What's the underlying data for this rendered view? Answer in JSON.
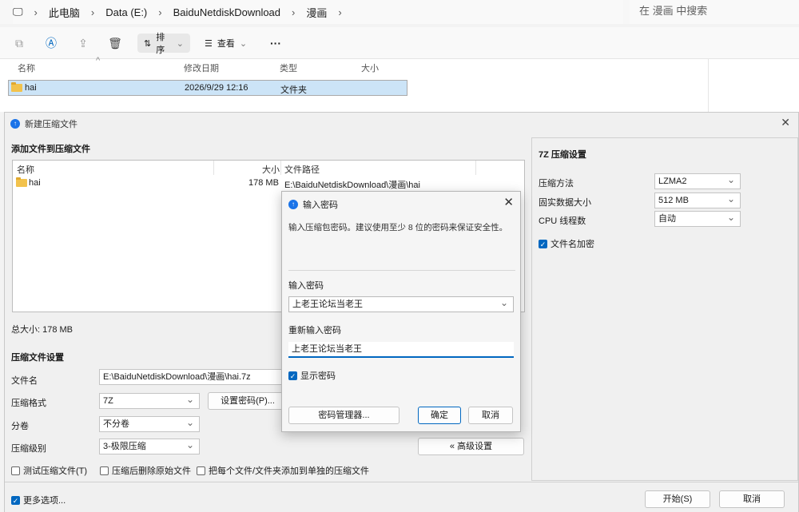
{
  "explorer": {
    "breadcrumb": [
      "此电脑",
      "Data (E:)",
      "BaiduNetdiskDownload",
      "漫画"
    ],
    "search_placeholder": "在 漫画 中搜索",
    "toolbar": {
      "sort_label": "排序",
      "view_label": "查看",
      "more_label": "···"
    },
    "columns": [
      "名称",
      "修改日期",
      "类型",
      "大小"
    ],
    "rows": [
      {
        "name": "hai",
        "modified": "2026/9/29 12:16",
        "type": "文件夹",
        "size": ""
      }
    ]
  },
  "archive_dialog": {
    "title": "新建压缩文件",
    "add_files_heading": "添加文件到压缩文件",
    "file_columns": [
      "名称",
      "大小",
      "文件路径"
    ],
    "files": [
      {
        "name": "hai",
        "size": "178 MB",
        "path": "E:\\BaiduNetdiskDownload\\漫画\\hai"
      }
    ],
    "total_size": "总大小: 178 MB",
    "settings_heading": "压缩文件设置",
    "filename_label": "文件名",
    "filename_value": "E:\\BaiduNetdiskDownload\\漫画\\hai.7z",
    "format_label": "压缩格式",
    "format_value": "7Z",
    "set_password_button": "设置密码(P)...",
    "split_label": "分卷",
    "split_value": "不分卷",
    "level_label": "压缩级别",
    "level_value": "3-极限压缩",
    "advanced_button": "« 高级设置",
    "test_checkbox": "测试压缩文件(T)",
    "delete_checkbox": "压缩后删除原始文件",
    "separate_checkbox": "把每个文件/文件夹添加到单独的压缩文件",
    "more_options": "更多选项...",
    "start_button": "开始(S)",
    "cancel_button": "取消",
    "sevenzip": {
      "heading": "7Z 压缩设置",
      "method_label": "压缩方法",
      "method_value": "LZMA2",
      "solid_label": "固实数据大小",
      "solid_value": "512 MB",
      "threads_label": "CPU 线程数",
      "threads_value": "自动",
      "encrypt_names": "文件名加密"
    }
  },
  "password_dialog": {
    "title": "输入密码",
    "hint": "输入压缩包密码。建议使用至少 8 位的密码来保证安全性。",
    "enter_label": "输入密码",
    "enter_value": "上老王论坛当老王",
    "reenter_label": "重新输入密码",
    "reenter_value": "上老王论坛当老王",
    "show_password": "显示密码",
    "manager_button": "密码管理器...",
    "ok_button": "确定",
    "cancel_button": "取消"
  }
}
